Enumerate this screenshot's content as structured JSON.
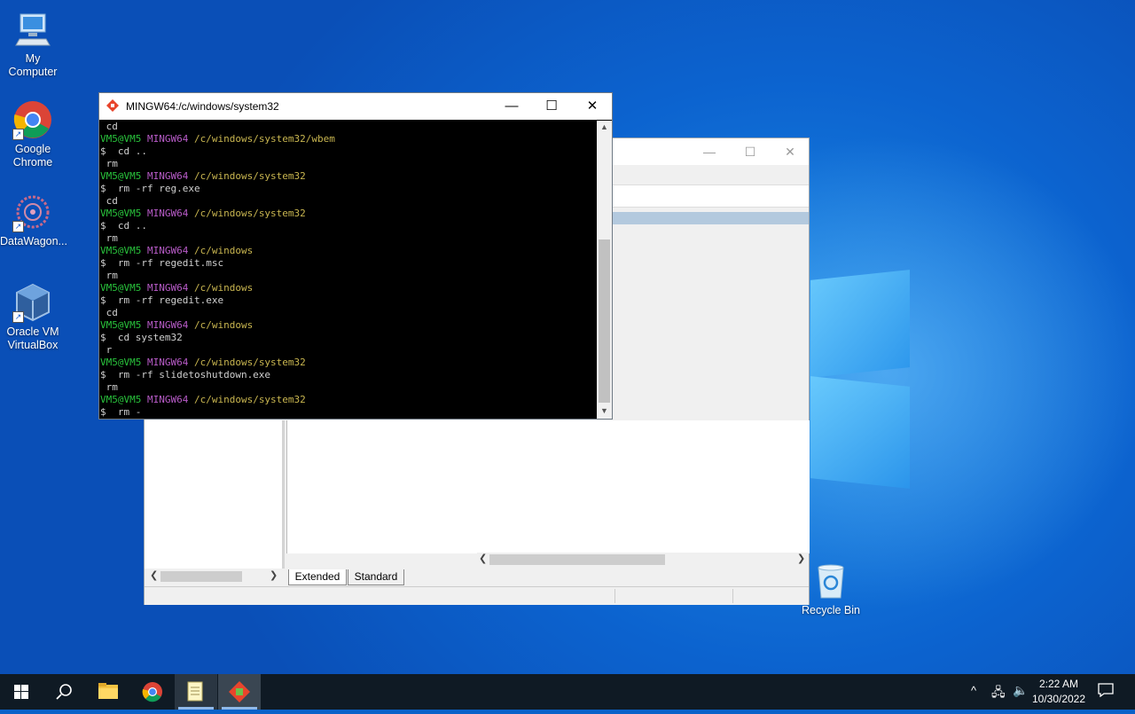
{
  "desktop_icons": [
    {
      "name": "my-computer",
      "label": "My Computer"
    },
    {
      "name": "google-chrome",
      "label": "Google Chrome"
    },
    {
      "name": "datawagon",
      "label": "DataWagon..."
    },
    {
      "name": "virtualbox",
      "label": "Oracle VM VirtualBox"
    },
    {
      "name": "recycle-bin",
      "label": "Recycle Bin"
    }
  ],
  "terminal": {
    "title": "MINGW64:/c/windows/system32",
    "prompt_user": "VM5@VM5",
    "prompt_system": "MINGW64",
    "lines": [
      {
        "type": "out",
        "text": " cd"
      },
      {
        "type": "prompt",
        "path": "/c/windows/system32/wbem"
      },
      {
        "type": "cmd",
        "text": "$  cd .."
      },
      {
        "type": "out",
        "text": " rm"
      },
      {
        "type": "prompt",
        "path": "/c/windows/system32"
      },
      {
        "type": "cmd",
        "text": "$  rm -rf reg.exe"
      },
      {
        "type": "out",
        "text": " cd"
      },
      {
        "type": "prompt",
        "path": "/c/windows/system32"
      },
      {
        "type": "cmd",
        "text": "$  cd .."
      },
      {
        "type": "out",
        "text": " rm"
      },
      {
        "type": "prompt",
        "path": "/c/windows"
      },
      {
        "type": "cmd",
        "text": "$  rm -rf regedit.msc"
      },
      {
        "type": "out",
        "text": " rm"
      },
      {
        "type": "prompt",
        "path": "/c/windows"
      },
      {
        "type": "cmd",
        "text": "$  rm -rf regedit.exe"
      },
      {
        "type": "out",
        "text": " cd"
      },
      {
        "type": "prompt",
        "path": "/c/windows"
      },
      {
        "type": "cmd",
        "text": "$  cd system32"
      },
      {
        "type": "out",
        "text": " r"
      },
      {
        "type": "prompt",
        "path": "/c/windows/system32"
      },
      {
        "type": "cmd",
        "text": "$  rm -rf slidetoshutdown.exe"
      },
      {
        "type": "out",
        "text": " rm"
      },
      {
        "type": "prompt",
        "path": "/c/windows/system32"
      },
      {
        "type": "cmd",
        "text": "$  rm -"
      }
    ]
  },
  "back_window": {
    "tabs": [
      {
        "label": "Extended"
      },
      {
        "label": "Standard"
      }
    ]
  },
  "taskbar": {
    "time": "2:22 AM",
    "date": "10/30/2022"
  },
  "colors": {
    "terminal_green": "#29c33c",
    "terminal_purple": "#b95cc9",
    "terminal_yellow": "#c9b650"
  }
}
